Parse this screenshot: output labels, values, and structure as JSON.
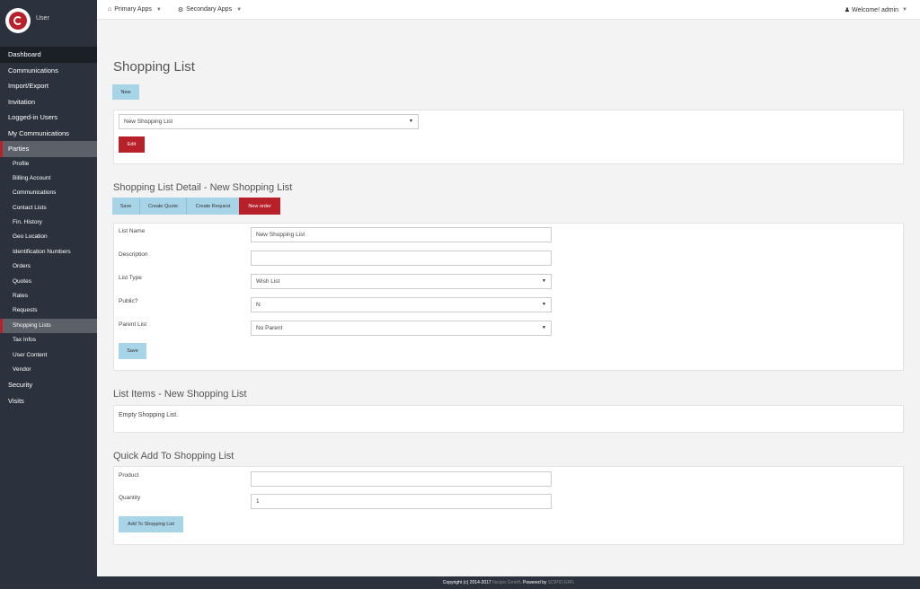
{
  "sidebar": {
    "brand_label": "User",
    "items": [
      {
        "label": "Dashboard"
      },
      {
        "label": "Communications"
      },
      {
        "label": "Import/Export"
      },
      {
        "label": "Invitation"
      },
      {
        "label": "Logged-in Users"
      },
      {
        "label": "My Communications"
      },
      {
        "label": "Parties"
      }
    ],
    "sub_items": [
      {
        "label": "Profile"
      },
      {
        "label": "Billing Account"
      },
      {
        "label": "Communications"
      },
      {
        "label": "Contact Lists"
      },
      {
        "label": "Fin. History"
      },
      {
        "label": "Geo Location"
      },
      {
        "label": "Identification Numbers"
      },
      {
        "label": "Orders"
      },
      {
        "label": "Quotes"
      },
      {
        "label": "Rates"
      },
      {
        "label": "Requests"
      },
      {
        "label": "Shopping Lists"
      },
      {
        "label": "Tax Infos"
      },
      {
        "label": "User Content"
      },
      {
        "label": "Vendor"
      }
    ],
    "bottom_items": [
      {
        "label": "Security"
      },
      {
        "label": "Visits"
      }
    ]
  },
  "topbar": {
    "primary_apps": "Primary Apps",
    "secondary_apps": "Secondary Apps",
    "welcome": "Welcome! admin"
  },
  "page": {
    "title": "Shopping List",
    "new_button": "New",
    "list_select_value": "New Shopping List",
    "edit_button": "Edit"
  },
  "detail": {
    "title": "Shopping List Detail - New Shopping List",
    "actions": {
      "save": "Save",
      "create_quote": "Create Quote",
      "create_request": "Create Request",
      "new_order": "New order"
    },
    "fields": {
      "list_name_label": "List Name",
      "list_name_value": "New Shopping List",
      "description_label": "Description",
      "description_value": "",
      "list_type_label": "List Type",
      "list_type_value": "Wish List",
      "public_label": "Public?",
      "public_value": "N",
      "parent_list_label": "Parent List",
      "parent_list_value": "No Parent"
    },
    "save_button": "Save"
  },
  "list_items": {
    "title": "List Items - New Shopping List",
    "empty_message": "Empty Shopping List."
  },
  "quick_add": {
    "title": "Quick Add To Shopping List",
    "product_label": "Product",
    "product_value": "",
    "quantity_label": "Quantity",
    "quantity_value": "1",
    "add_button": "Add To Shopping List"
  },
  "footer": {
    "copyright": "Copyright (c) 2014-2017",
    "company": "Ilscipio GmbH",
    "powered_by": ". Powered by",
    "product": "SCIPIO ERP",
    "end": "."
  },
  "colors": {
    "sidebar_bg": "#2c323d",
    "accent_red": "#b8202a",
    "button_blue": "#a8d4e8"
  }
}
